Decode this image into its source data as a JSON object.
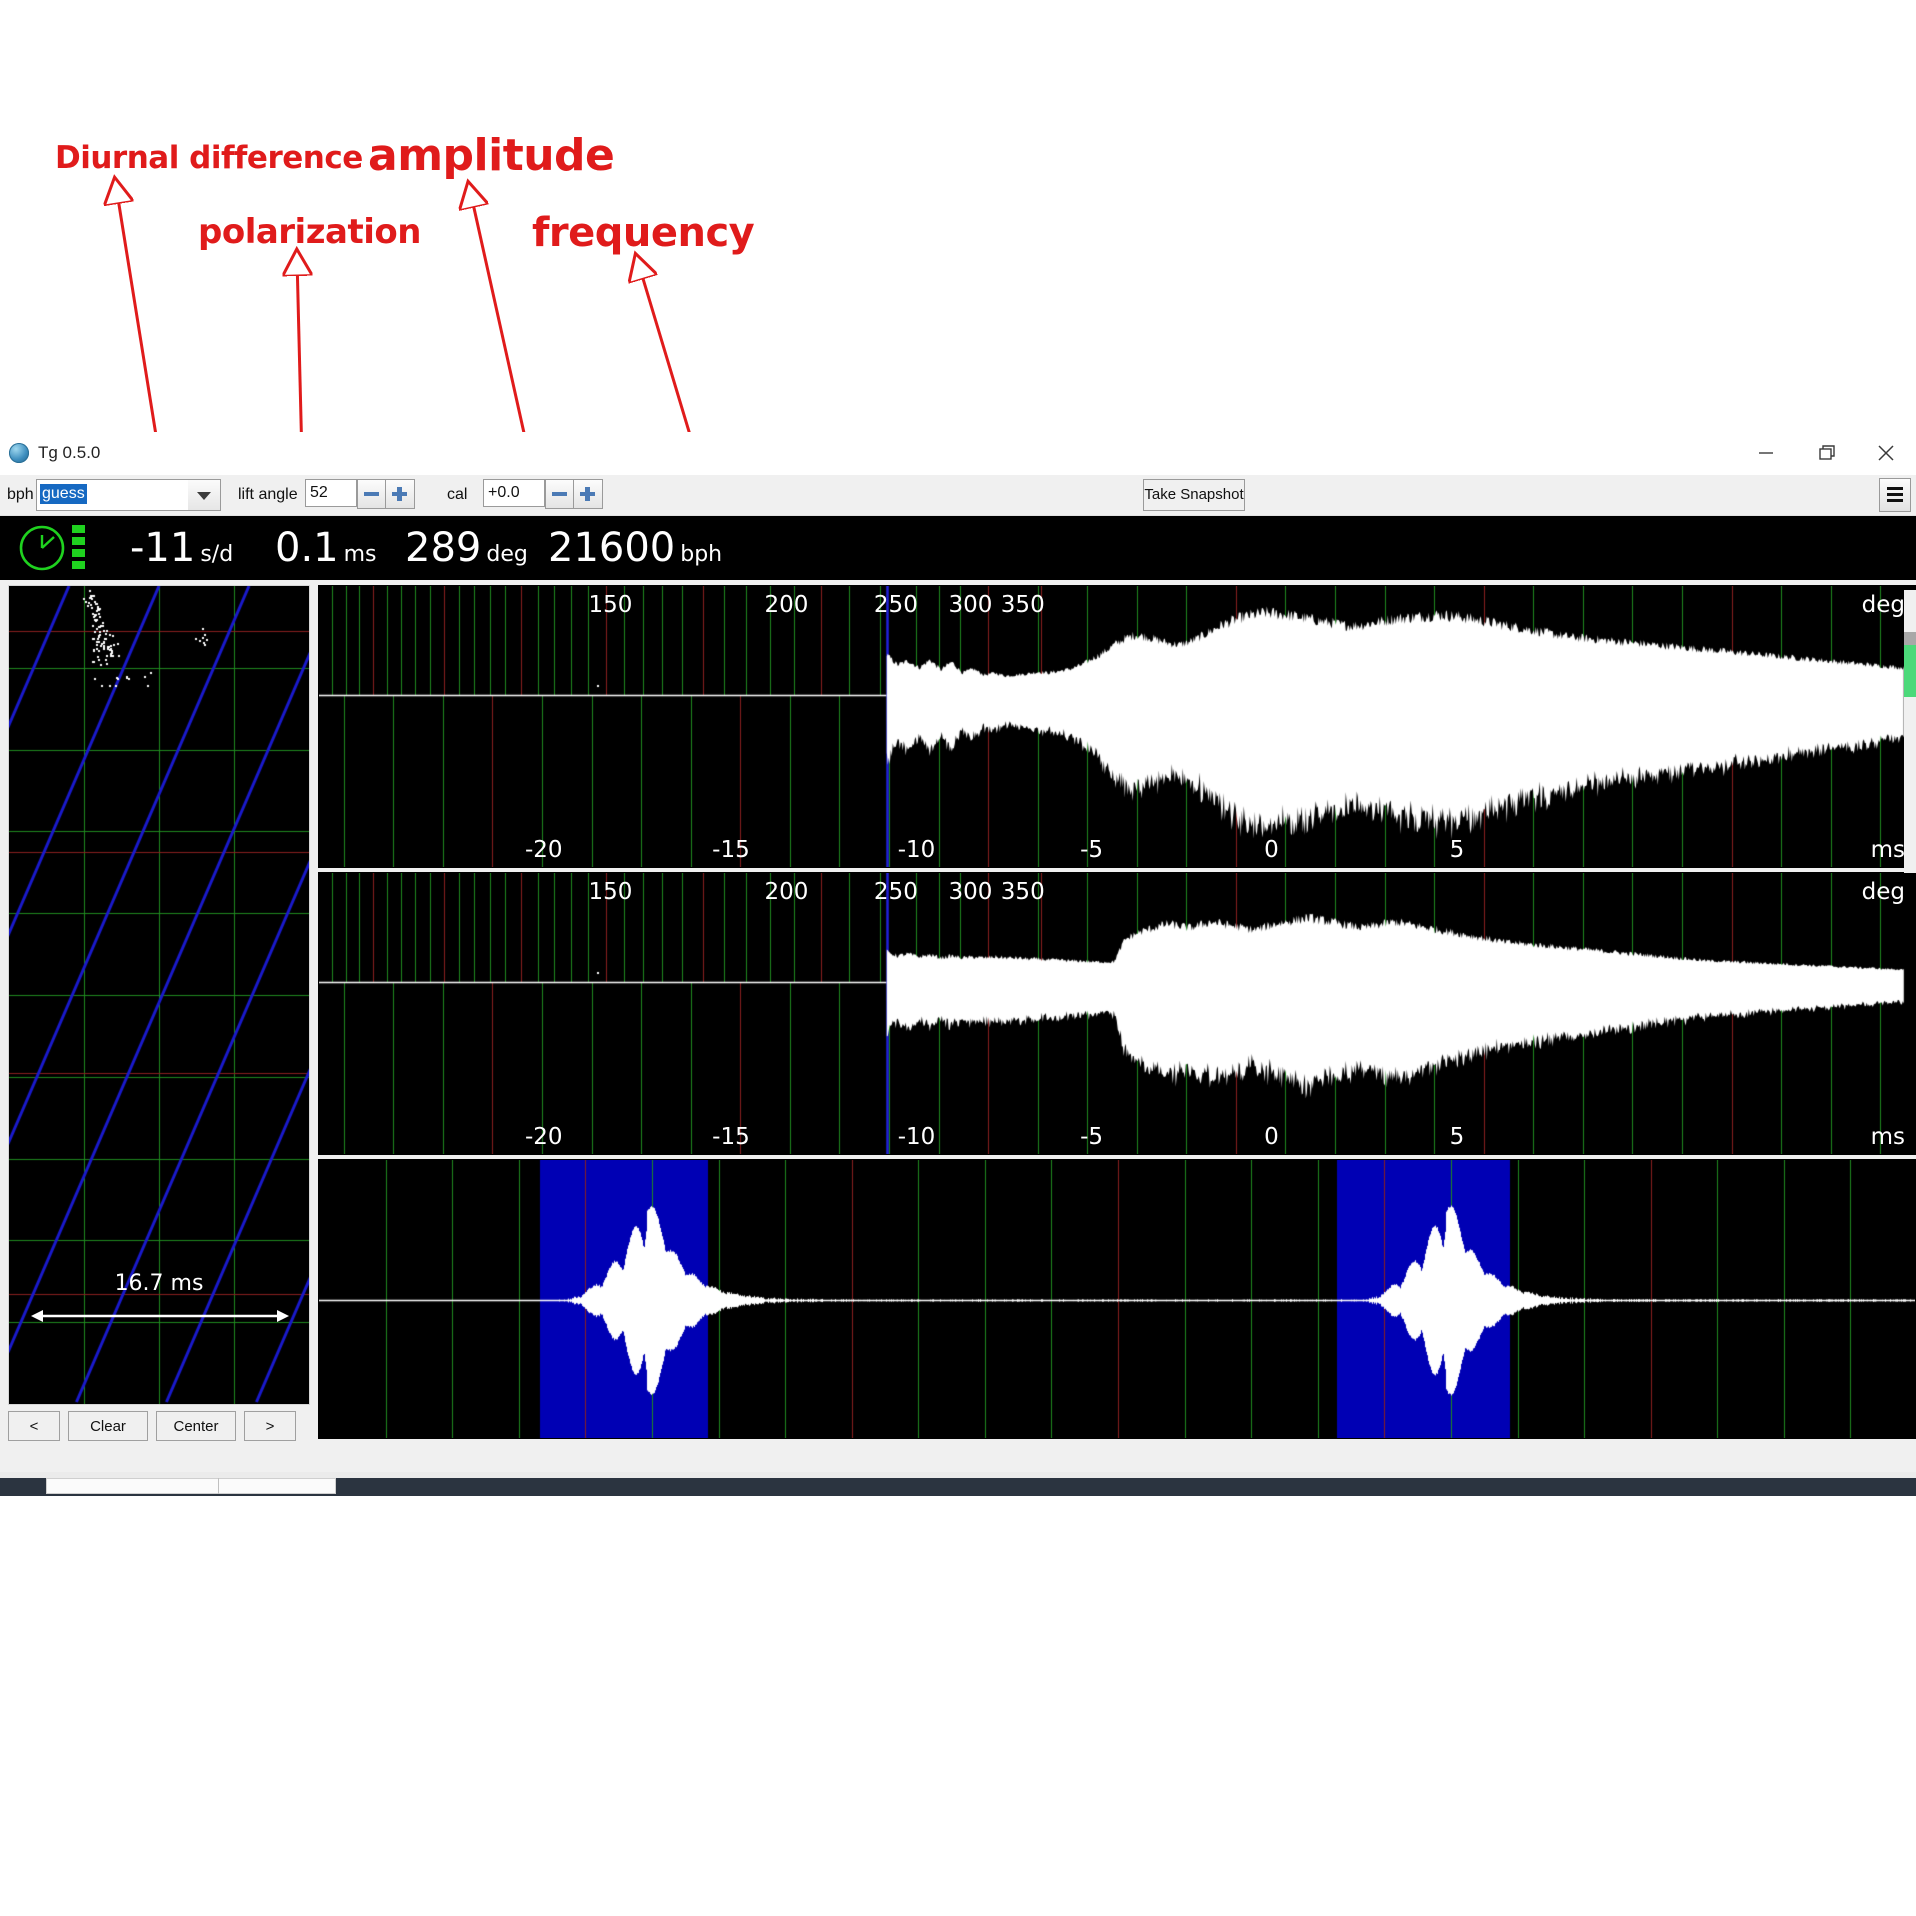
{
  "annotations": [
    {
      "id": "diurnal",
      "text": "Diurnal difference"
    },
    {
      "id": "polarization",
      "text": "polarization"
    },
    {
      "id": "amplitude",
      "text": "amplitude"
    },
    {
      "id": "frequency",
      "text": "frequency"
    }
  ],
  "annotation_color": "#e01b1b",
  "window": {
    "title": "Tg 0.5.0",
    "icon": "app-globe-icon",
    "minimize_label": "minimize-icon",
    "maximize_label": "maximize-icon",
    "close_label": "close-icon"
  },
  "toolbar": {
    "bph_label": "bph",
    "bph_value": "guess",
    "bph_dropdown_icon": "chevron-down-icon",
    "lift_angle_label": "lift angle",
    "lift_angle_value": "52",
    "cal_label": "cal",
    "cal_value": "+0.0",
    "snapshot_label": "Take Snapshot",
    "menu_icon": "hamburger-icon",
    "minus_icon": "minus-icon",
    "plus_icon": "plus-icon"
  },
  "readout": {
    "clock_icon": "clock-icon",
    "signal_icon": "signal-strength-icon",
    "rate_value": "-11",
    "rate_unit": "s/d",
    "beat_error_value": "0.1",
    "beat_error_unit": "ms",
    "amplitude_value": "289",
    "amplitude_unit": "deg",
    "bph_value": "21600",
    "bph_unit": "bph",
    "accent_green": "#1fd21f"
  },
  "left_panel": {
    "span_label": "16.7 ms",
    "arrow_icon": "double-arrow-icon",
    "buttons": [
      {
        "name": "prev",
        "label": "<"
      },
      {
        "name": "clear",
        "label": "Clear"
      },
      {
        "name": "center",
        "label": "Center"
      },
      {
        "name": "next",
        "label": ">"
      }
    ]
  },
  "scrollbar": {
    "name": "vertical-scrollbar",
    "thumb_color": "#4cd97a"
  },
  "chart_data": [
    {
      "type": "area",
      "name": "tick-trace-paperstrip",
      "title": "",
      "xlabel": "",
      "ylabel": "",
      "grid": true,
      "bg": "#000000",
      "grid_color_h": "#1f8a1f",
      "grid_color_red": "#8a1f1f",
      "trace_color": "#1a1acc",
      "point_color": "#ffffff",
      "annotation": "16.7 ms",
      "x_span_ms": 16.7,
      "rows": 10,
      "trace_slope_per_row": -0.62,
      "traces": 5
    },
    {
      "type": "area",
      "name": "amplitude-waveform-top",
      "title": "",
      "xlabel": "ms",
      "ylabel": "deg",
      "grid": true,
      "bg": "#000000",
      "wave_color": "#ffffff",
      "gridline_green": "#1f8a1f",
      "gridline_red": "#8a1f1f",
      "cursor_color": "#2222dd",
      "top_axis_label": "deg",
      "bottom_axis_label": "ms",
      "top_ticks": [
        {
          "label": "150",
          "x_frac": 0.168
        },
        {
          "label": "200",
          "x_frac": 0.279
        },
        {
          "label": "250",
          "x_frac": 0.348
        },
        {
          "label": "300",
          "x_frac": 0.395
        },
        {
          "label": "350",
          "x_frac": 0.428
        }
      ],
      "bottom_ticks": [
        {
          "label": "-20",
          "x_frac": 0.128
        },
        {
          "label": "-15",
          "x_frac": 0.246
        },
        {
          "label": "-10",
          "x_frac": 0.363
        },
        {
          "label": "-5",
          "x_frac": 0.478
        },
        {
          "label": "0",
          "x_frac": 0.594
        },
        {
          "label": "5",
          "x_frac": 0.711
        }
      ],
      "cursor_x_frac": 0.358,
      "xlim_ms": [
        -23.5,
        8.5
      ],
      "envelope": [
        0,
        0,
        0,
        0,
        0,
        0,
        0,
        0,
        0,
        0,
        0,
        0,
        0,
        0,
        0,
        0,
        0,
        0,
        0,
        0,
        0,
        0,
        0,
        0,
        0,
        0,
        0,
        0,
        0,
        0,
        0,
        0,
        0,
        0,
        0,
        0.4,
        0.3,
        0.34,
        0.27,
        0.35,
        0.25,
        0.33,
        0.22,
        0.26,
        0.2,
        0.22,
        0.19,
        0.2,
        0.21,
        0.23,
        0.22,
        0.24,
        0.26,
        0.3,
        0.36,
        0.42,
        0.5,
        0.56,
        0.6,
        0.58,
        0.55,
        0.52,
        0.5,
        0.53,
        0.58,
        0.64,
        0.7,
        0.74,
        0.78,
        0.8,
        0.82,
        0.81,
        0.8,
        0.78,
        0.76,
        0.74,
        0.72,
        0.7,
        0.69,
        0.7,
        0.72,
        0.74,
        0.76,
        0.77,
        0.78,
        0.79,
        0.8,
        0.79,
        0.78,
        0.76,
        0.74,
        0.72,
        0.7,
        0.68,
        0.66,
        0.64,
        0.62,
        0.6,
        0.58,
        0.57,
        0.56,
        0.55,
        0.54,
        0.53,
        0.52,
        0.51,
        0.5,
        0.49,
        0.48,
        0.47,
        0.46,
        0.45,
        0.44,
        0.43,
        0.42,
        0.41,
        0.4,
        0.39,
        0.38,
        0.37,
        0.36,
        0.35,
        0.34,
        0.33,
        0.32,
        0.31,
        0.3,
        0.29,
        0.28,
        0.27
      ]
    },
    {
      "type": "area",
      "name": "amplitude-waveform-bottom",
      "title": "",
      "xlabel": "ms",
      "ylabel": "deg",
      "grid": true,
      "bg": "#000000",
      "wave_color": "#ffffff",
      "top_axis_label": "deg",
      "bottom_axis_label": "ms",
      "top_ticks": [
        {
          "label": "150",
          "x_frac": 0.168
        },
        {
          "label": "200",
          "x_frac": 0.279
        },
        {
          "label": "250",
          "x_frac": 0.348
        },
        {
          "label": "300",
          "x_frac": 0.395
        },
        {
          "label": "350",
          "x_frac": 0.428
        }
      ],
      "bottom_ticks": [
        {
          "label": "-20",
          "x_frac": 0.128
        },
        {
          "label": "-15",
          "x_frac": 0.246
        },
        {
          "label": "-10",
          "x_frac": 0.363
        },
        {
          "label": "-5",
          "x_frac": 0.478
        },
        {
          "label": "0",
          "x_frac": 0.594
        },
        {
          "label": "5",
          "x_frac": 0.711
        }
      ],
      "cursor_x_frac": 0.358,
      "xlim_ms": [
        -23.5,
        8.5
      ],
      "envelope": [
        0,
        0,
        0,
        0,
        0,
        0,
        0,
        0,
        0,
        0,
        0,
        0,
        0,
        0,
        0,
        0,
        0,
        0,
        0,
        0,
        0,
        0,
        0,
        0,
        0,
        0,
        0,
        0,
        0,
        0,
        0,
        0,
        0,
        0,
        0,
        0.3,
        0.26,
        0.28,
        0.25,
        0.27,
        0.24,
        0.26,
        0.24,
        0.25,
        0.24,
        0.25,
        0.24,
        0.24,
        0.23,
        0.23,
        0.22,
        0.22,
        0.21,
        0.21,
        0.2,
        0.2,
        0.2,
        0.42,
        0.48,
        0.52,
        0.55,
        0.58,
        0.56,
        0.54,
        0.57,
        0.6,
        0.58,
        0.56,
        0.54,
        0.52,
        0.55,
        0.58,
        0.6,
        0.62,
        0.64,
        0.62,
        0.6,
        0.58,
        0.56,
        0.54,
        0.56,
        0.58,
        0.6,
        0.58,
        0.56,
        0.54,
        0.52,
        0.5,
        0.48,
        0.46,
        0.44,
        0.42,
        0.4,
        0.39,
        0.38,
        0.37,
        0.36,
        0.35,
        0.34,
        0.33,
        0.32,
        0.31,
        0.3,
        0.29,
        0.28,
        0.27,
        0.26,
        0.25,
        0.24,
        0.23,
        0.22,
        0.21,
        0.21,
        0.2,
        0.2,
        0.19,
        0.19,
        0.18,
        0.18,
        0.17,
        0.17,
        0.16,
        0.16,
        0.15,
        0.15,
        0.14,
        0.14,
        0.13,
        0.13,
        0.12
      ]
    },
    {
      "type": "area",
      "name": "raw-signal-waveform",
      "title": "",
      "xlabel": "",
      "ylabel": "",
      "grid": true,
      "bg": "#000000",
      "wave_color": "#ffffff",
      "selection_color": "#0000b4",
      "selections": [
        {
          "start_frac": 0.138,
          "end_frac": 0.243
        },
        {
          "start_frac": 0.637,
          "end_frac": 0.745
        }
      ],
      "pulse_peaks_frac": [
        0.205,
        0.705
      ],
      "baseline_frac": 0.5
    }
  ]
}
